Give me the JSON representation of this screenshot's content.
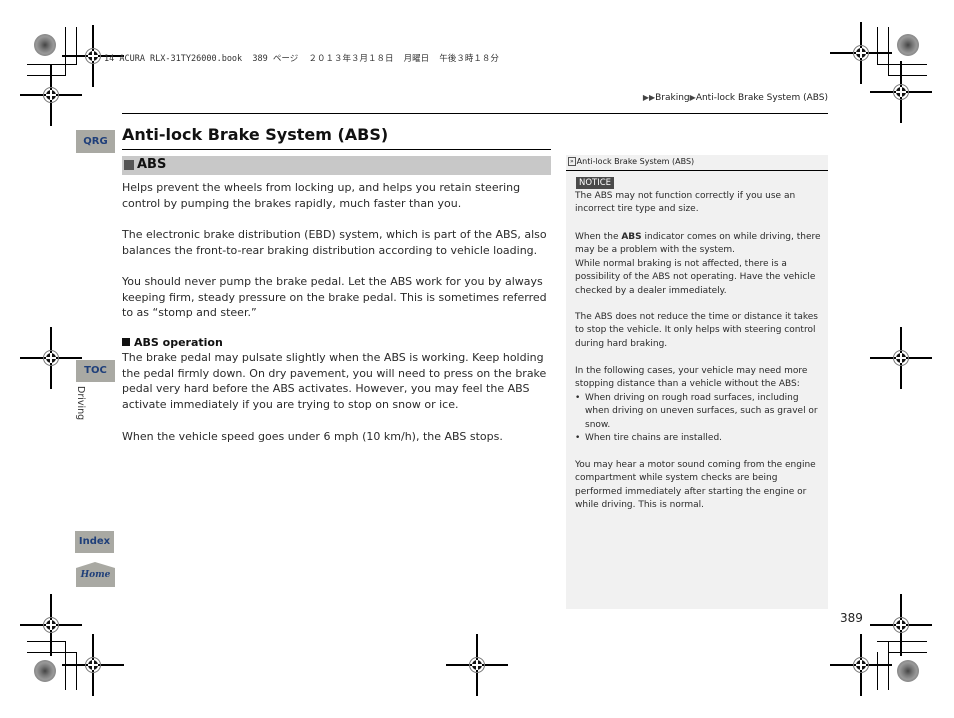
{
  "print_header": "14 ACURA RLX-31TY26000.book  389 ページ  ２０１３年３月１８日  月曜日  午後３時１８分",
  "breadcrumb": {
    "arrows": "▶▶",
    "items": [
      "Braking",
      "Anti-lock Brake System (ABS)"
    ],
    "separator": "▶"
  },
  "side_tabs": {
    "qrg": "QRG",
    "toc": "TOC",
    "chapter": "Driving",
    "index": "Index",
    "home": "Home"
  },
  "page_title": "Anti-lock Brake System (ABS)",
  "section": {
    "heading": "ABS",
    "paragraphs": [
      "Helps prevent the wheels from locking up, and helps you retain steering control by pumping the brakes rapidly, much faster than you.",
      "The electronic brake distribution (EBD) system, which is part of the ABS, also balances the front-to-rear braking distribution according to vehicle loading.",
      "You should never pump the brake pedal. Let the ABS work for you by always keeping firm, steady pressure on the brake pedal. This is sometimes referred to as “stomp and steer.”"
    ],
    "subsection": {
      "heading": "ABS operation",
      "paragraphs": [
        "The brake pedal may pulsate slightly when the ABS is working. Keep holding the pedal firmly down. On dry pavement, you will need to press on the brake pedal very hard before the ABS activates. However, you may feel the ABS activate immediately if you are trying to stop on snow or ice.",
        "When the vehicle speed goes under 6 mph (10 km/h), the ABS stops."
      ]
    }
  },
  "side_panel": {
    "title": "Anti-lock Brake System (ABS)",
    "notice_label": "NOTICE",
    "notice_text": "The ABS may not function correctly if you use an incorrect tire type and size.",
    "indicator_pre": "When the ",
    "indicator_bold": "ABS",
    "indicator_post": " indicator comes on while driving, there may be a problem with the system.",
    "indicator_follow": "While normal braking is not affected, there is a possibility of the ABS not operating. Have the vehicle checked by a dealer immediately.",
    "time_distance": "The ABS does not reduce the time or distance it takes to stop the vehicle. It only helps with steering control during hard braking.",
    "cases_intro": "In the following cases, your vehicle may need more stopping distance than a vehicle without the ABS:",
    "cases": [
      "When driving on rough road surfaces, including when driving on uneven surfaces, such as gravel or snow.",
      "When tire chains are installed."
    ],
    "motor_sound": "You may hear a motor sound coming from the engine compartment while system checks are being performed immediately after starting the engine or while driving. This is normal."
  },
  "page_number": "389"
}
